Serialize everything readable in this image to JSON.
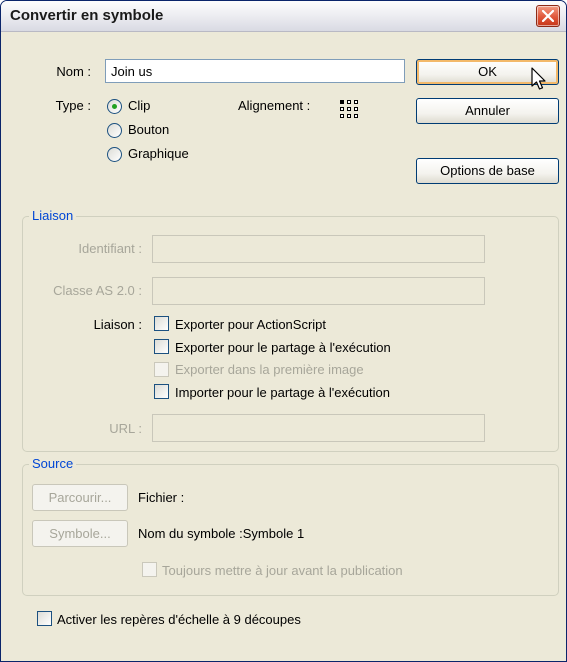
{
  "window": {
    "title": "Convertir en symbole"
  },
  "form": {
    "name_label": "Nom :",
    "name_value": "Join us",
    "type_label": "Type :",
    "type_options": [
      "Clip",
      "Bouton",
      "Graphique"
    ],
    "type_selected": "Clip",
    "alignment_label": "Alignement :"
  },
  "buttons": {
    "ok": "OK",
    "cancel": "Annuler",
    "basic": "Options de base"
  },
  "linkage": {
    "title": "Liaison",
    "identifier_label": "Identifiant :",
    "class_label": "Classe AS 2.0 :",
    "linkage_label": "Liaison :",
    "options": [
      "Exporter pour ActionScript",
      "Exporter pour le partage à l'exécution",
      "Exporter dans la première image",
      "Importer pour le partage à l'exécution"
    ],
    "url_label": "URL :"
  },
  "source": {
    "title": "Source",
    "browse_button": "Parcourir...",
    "file_label": "Fichier :",
    "symbol_button": "Symbole...",
    "symbol_name": "Nom du symbole :Symbole 1",
    "always_update": "Toujours mettre à jour avant la publication"
  },
  "scale9": {
    "label": "Activer les repères d'échelle à 9 découpes"
  },
  "colors": {
    "accent": "#0046d5",
    "close": "#e0563a",
    "default_focus": "#f3b96a"
  }
}
